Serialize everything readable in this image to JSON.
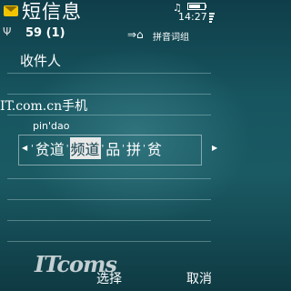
{
  "status_bar": {
    "title": "短信息",
    "time": "14:27",
    "icons": [
      "message-envelope-icon",
      "signal-icon",
      "headset-icon",
      "battery-icon"
    ]
  },
  "editor": {
    "char_counter": "59 (1)",
    "input_mode": "拼音词组",
    "recipient_label": "收件人"
  },
  "watermark_top": "IT.com.cn手机",
  "ime": {
    "pinyin": "pin'dao",
    "candidates": [
      "贫道",
      "频道",
      "品",
      "拼",
      "贫"
    ],
    "selected_index": 1
  },
  "watermark_bottom": "ITcoms",
  "softkeys": {
    "left": "选择",
    "right": "取消"
  }
}
